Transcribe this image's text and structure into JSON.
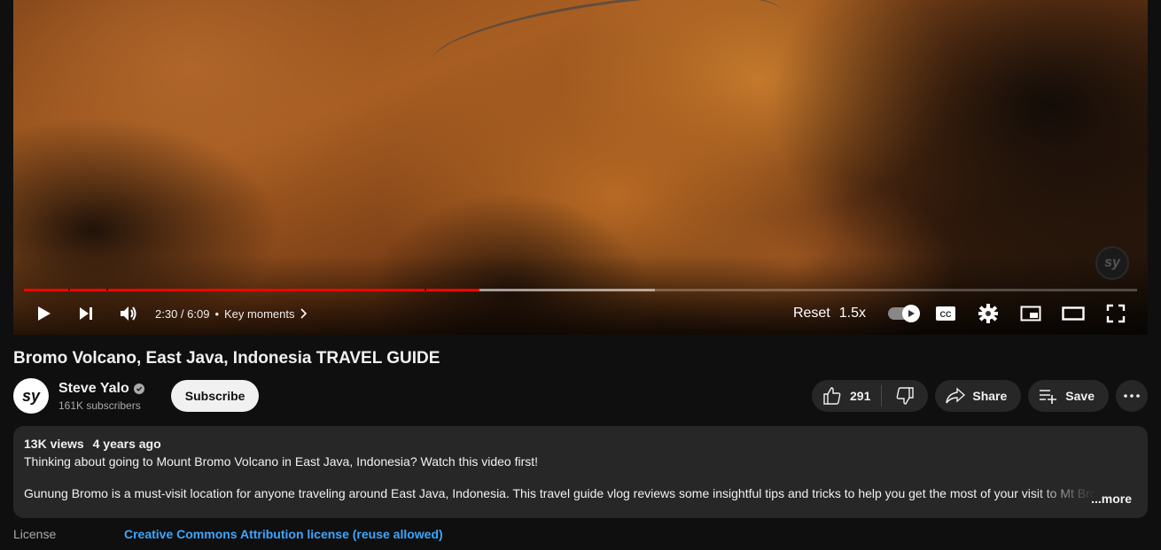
{
  "player": {
    "watermark": "sy",
    "progress_fraction": 0.4092,
    "buffer_fraction": 0.567,
    "time": "2:30 / 6:09",
    "separator": "•",
    "key_moments": "Key moments",
    "reset": "Reset",
    "speed": "1.5x",
    "icons": [
      "play-icon",
      "next-icon",
      "volume-icon",
      "chevron-right-icon",
      "autoplay-toggle",
      "captions-icon",
      "settings-icon",
      "miniplayer-icon",
      "theater-icon",
      "fullscreen-icon"
    ]
  },
  "video": {
    "title": "Bromo Volcano, East Java, Indonesia TRAVEL GUIDE"
  },
  "channel": {
    "avatar_text": "sy",
    "name": "Steve Yalo",
    "subscribers": "161K subscribers",
    "subscribe_label": "Subscribe"
  },
  "actions": {
    "likes": "291",
    "share_label": "Share",
    "save_label": "Save"
  },
  "description": {
    "views": "13K views",
    "age": "4 years ago",
    "line1": "Thinking about going to Mount Bromo Volcano in East Java, Indonesia? Watch this video first!",
    "line2": "Gunung Bromo is a must-visit location for anyone traveling around East Java, Indonesia. This travel guide vlog reviews some insightful tips and tricks to help you get the most of your visit to Mt Bromo",
    "more_label": "...more"
  },
  "license": {
    "label": "License",
    "value": "Creative Commons Attribution license (reuse allowed)"
  },
  "colors": {
    "background": "#0f0f0f",
    "progress": "#ff0000",
    "link": "#3ea6ff",
    "pill": "#272727"
  }
}
